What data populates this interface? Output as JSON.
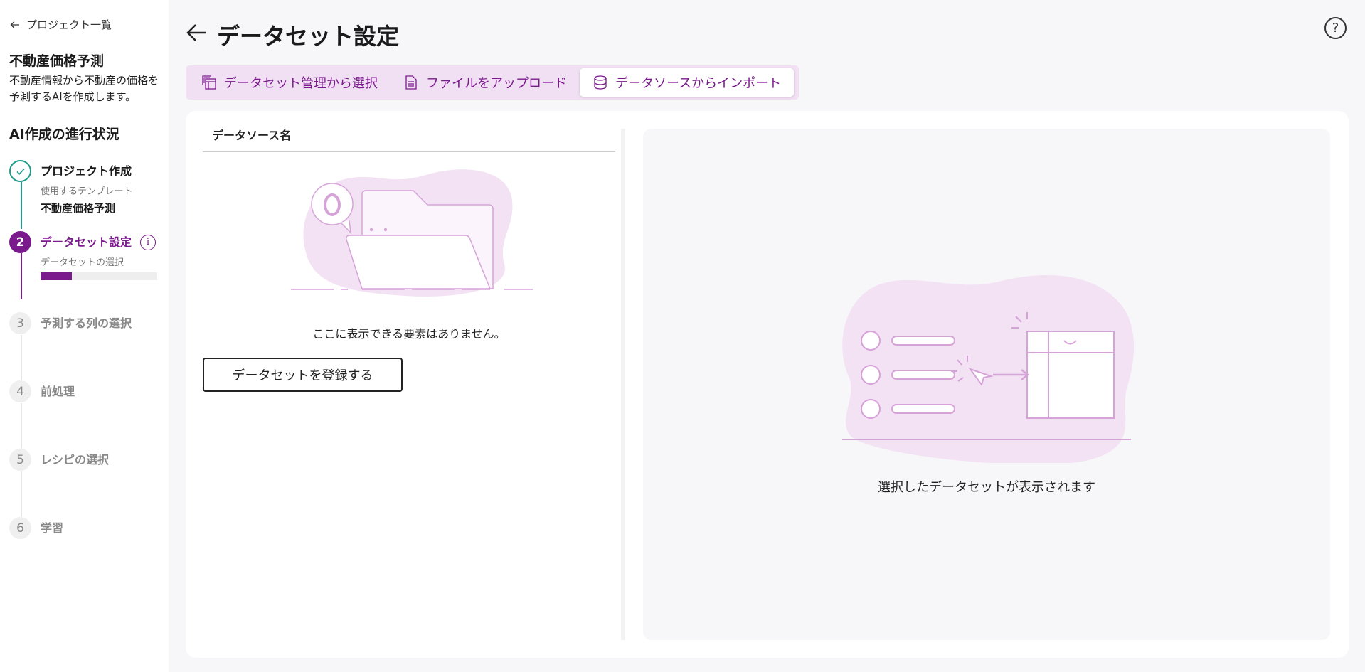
{
  "sidebar": {
    "back_label": "プロジェクト一覧",
    "project_name": "不動産価格予測",
    "project_desc": "不動産情報から不動産の価格を予測するAIを作成します。",
    "progress_title": "AI作成の進行状況",
    "steps": [
      {
        "number": "",
        "label": "プロジェクト作成",
        "sub": "使用するテンプレート",
        "value": "不動産価格予測",
        "status": "done"
      },
      {
        "number": "2",
        "label": "データセット設定",
        "sub": "データセットの選択",
        "progress": 0.27,
        "status": "active"
      },
      {
        "number": "3",
        "label": "予測する列の選択",
        "status": "pending"
      },
      {
        "number": "4",
        "label": "前処理",
        "status": "pending"
      },
      {
        "number": "5",
        "label": "レシピの選択",
        "status": "pending"
      },
      {
        "number": "6",
        "label": "学習",
        "status": "pending"
      }
    ]
  },
  "header": {
    "title": "データセット設定"
  },
  "tabs": [
    {
      "label": "データセット管理から選択",
      "icon": "dataset-table-icon",
      "active": false
    },
    {
      "label": "ファイルをアップロード",
      "icon": "document-icon",
      "active": false
    },
    {
      "label": "データソースからインポート",
      "icon": "database-icon",
      "active": true
    }
  ],
  "main": {
    "column_header": "データソース名",
    "empty_message": "ここに表示できる要素はありません。",
    "register_button": "データセットを登録する",
    "preview_message": "選択したデータセットが表示されます"
  },
  "colors": {
    "accent": "#7a1a8c",
    "done": "#1f9d8a",
    "tab_bg": "#f1dff3",
    "illus_fill": "#f3e1f4",
    "illus_stroke": "#d6a3d9"
  }
}
